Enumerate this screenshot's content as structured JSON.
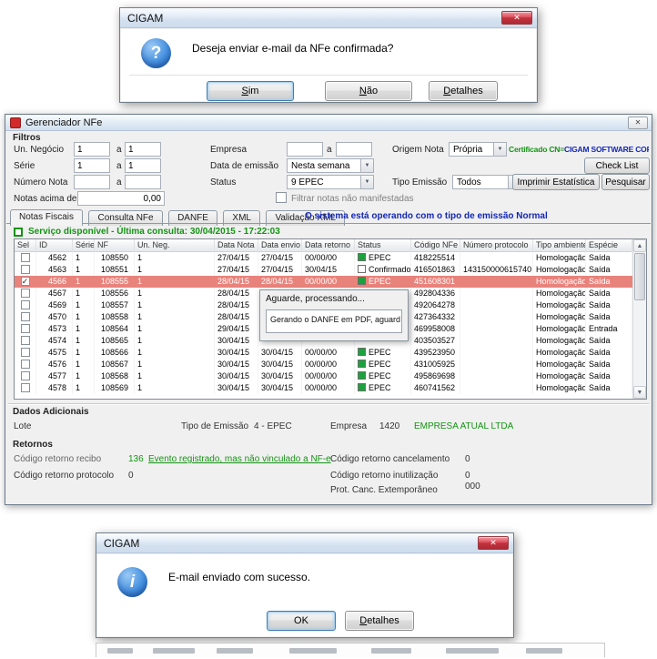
{
  "colors": {
    "epec_green": "#1aa23c",
    "confirmado_fill": "#ffffff",
    "selected_row": "#e8837c",
    "green_text": "#149414",
    "blue_text": "#1226b5"
  },
  "dialog_email_question": {
    "title": "CIGAM",
    "message": "Deseja enviar e-mail da NFe confirmada?",
    "buttons": {
      "yes": "Sim",
      "no": "Não",
      "details": "Detalhes"
    }
  },
  "dialog_email_success": {
    "title": "CIGAM",
    "message": "E-mail enviado com sucesso.",
    "buttons": {
      "ok": "OK",
      "details": "Detalhes"
    }
  },
  "progress_popup": {
    "title": "Aguarde, processando...",
    "message": "Gerando o DANFE em PDF, aguard"
  },
  "main": {
    "title": "Gerenciador NFe",
    "filters": {
      "legend": "Filtros",
      "a_label": "a",
      "un_negocio_label": "Un. Negócio",
      "un_negocio_from": "1",
      "un_negocio_to": "1",
      "serie_label": "Série",
      "serie_from": "1",
      "serie_to": "1",
      "numero_nota_label": "Número Nota",
      "numero_nota_from": "",
      "numero_nota_to": "",
      "notas_acima_label": "Notas acima de",
      "notas_acima_value": "0,00",
      "empresa_label": "Empresa",
      "empresa_from": "",
      "empresa_to": "",
      "data_emissao_label": "Data de emissão",
      "data_emissao_value": "Nesta semana",
      "status_label": "Status",
      "status_value": "9 EPEC",
      "origem_label": "Origem Nota",
      "origem_value": "Própria",
      "tipo_emissao_label": "Tipo Emissão",
      "tipo_emissao_value": "Todos",
      "certificado_prefix": "Certificado CN=",
      "certificado_value": "CIGAM SOFTWARE CORPORATIV",
      "check_list_button": "Check List",
      "imprimir_button": "Imprimir Estatística",
      "pesquisar_button": "Pesquisar",
      "filtrar_label": "Filtrar notas não manifestadas"
    },
    "tabs": [
      "Notas Fiscais",
      "Consulta NFe",
      "DANFE",
      "XML",
      "Validação XML"
    ],
    "emission_message": "O sistema está operando com o tipo de emissão Normal",
    "service_status": "Serviço disponível - Última consulta: 30/04/2015 - 17:22:03",
    "table": {
      "headers": [
        "Sel",
        "ID",
        "Série",
        "NF",
        "Un. Neg.",
        "Data Nota",
        "Data envio",
        "Data retorno",
        "Status",
        "Código NFe",
        "Número protocolo",
        "Tipo ambiente",
        "Espécie"
      ],
      "rows": [
        {
          "sel": false,
          "selected": false,
          "id": "4562",
          "serie": "1",
          "nf": "108550",
          "un": "1",
          "dn": "27/04/15",
          "de": "27/04/15",
          "dr": "00/00/00",
          "status": "EPEC",
          "st": "epec",
          "cod": "418225514",
          "prot": "",
          "amb": "Homologação",
          "esp": "Saída"
        },
        {
          "sel": false,
          "selected": false,
          "id": "4563",
          "serie": "1",
          "nf": "108551",
          "un": "1",
          "dn": "27/04/15",
          "de": "27/04/15",
          "dr": "30/04/15",
          "status": "Confirmado",
          "st": "confirmado",
          "cod": "416501863",
          "prot": "143150000615740",
          "amb": "Homologação",
          "esp": "Saída"
        },
        {
          "sel": true,
          "selected": true,
          "id": "4566",
          "serie": "1",
          "nf": "108555",
          "un": "1",
          "dn": "28/04/15",
          "de": "28/04/15",
          "dr": "00/00/00",
          "status": "EPEC",
          "st": "epec",
          "cod": "451608301",
          "prot": "",
          "amb": "Homologação",
          "esp": "Saída"
        },
        {
          "sel": false,
          "selected": false,
          "id": "4567",
          "serie": "1",
          "nf": "108556",
          "un": "1",
          "dn": "28/04/15",
          "de": "",
          "dr": "",
          "status": "",
          "st": "",
          "cod": "492804336",
          "prot": "",
          "amb": "Homologação",
          "esp": "Saída"
        },
        {
          "sel": false,
          "selected": false,
          "id": "4569",
          "serie": "1",
          "nf": "108557",
          "un": "1",
          "dn": "28/04/15",
          "de": "",
          "dr": "",
          "status": "",
          "st": "",
          "cod": "492064278",
          "prot": "",
          "amb": "Homologação",
          "esp": "Saída"
        },
        {
          "sel": false,
          "selected": false,
          "id": "4570",
          "serie": "1",
          "nf": "108558",
          "un": "1",
          "dn": "28/04/15",
          "de": "",
          "dr": "",
          "status": "",
          "st": "",
          "cod": "427364332",
          "prot": "",
          "amb": "Homologação",
          "esp": "Saída"
        },
        {
          "sel": false,
          "selected": false,
          "id": "4573",
          "serie": "1",
          "nf": "108564",
          "un": "1",
          "dn": "29/04/15",
          "de": "",
          "dr": "",
          "status": "",
          "st": "",
          "cod": "469958008",
          "prot": "",
          "amb": "Homologação",
          "esp": "Entrada"
        },
        {
          "sel": false,
          "selected": false,
          "id": "4574",
          "serie": "1",
          "nf": "108565",
          "un": "1",
          "dn": "30/04/15",
          "de": "",
          "dr": "",
          "status": "",
          "st": "",
          "cod": "403503527",
          "prot": "",
          "amb": "Homologação",
          "esp": "Saída"
        },
        {
          "sel": false,
          "selected": false,
          "id": "4575",
          "serie": "1",
          "nf": "108566",
          "un": "1",
          "dn": "30/04/15",
          "de": "30/04/15",
          "dr": "00/00/00",
          "status": "EPEC",
          "st": "epec",
          "cod": "439523950",
          "prot": "",
          "amb": "Homologação",
          "esp": "Saída"
        },
        {
          "sel": false,
          "selected": false,
          "id": "4576",
          "serie": "1",
          "nf": "108567",
          "un": "1",
          "dn": "30/04/15",
          "de": "30/04/15",
          "dr": "00/00/00",
          "status": "EPEC",
          "st": "epec",
          "cod": "431005925",
          "prot": "",
          "amb": "Homologação",
          "esp": "Saída"
        },
        {
          "sel": false,
          "selected": false,
          "id": "4577",
          "serie": "1",
          "nf": "108568",
          "un": "1",
          "dn": "30/04/15",
          "de": "30/04/15",
          "dr": "00/00/00",
          "status": "EPEC",
          "st": "epec",
          "cod": "495869698",
          "prot": "",
          "amb": "Homologação",
          "esp": "Saída"
        },
        {
          "sel": false,
          "selected": false,
          "id": "4578",
          "serie": "1",
          "nf": "108569",
          "un": "1",
          "dn": "30/04/15",
          "de": "30/04/15",
          "dr": "00/00/00",
          "status": "EPEC",
          "st": "epec",
          "cod": "460741562",
          "prot": "",
          "amb": "Homologação",
          "esp": "Saída"
        }
      ]
    },
    "dados_adicionais": {
      "title": "Dados Adicionais",
      "lote_label": "Lote",
      "tipo_emissao_label": "Tipo de Emissão",
      "tipo_emissao_value": "4 - EPEC",
      "empresa_label": "Empresa",
      "empresa_code": "1420",
      "empresa_name": "EMPRESA ATUAL LTDA"
    },
    "retornos": {
      "title": "Retornos",
      "recibo_label": "Código retorno recibo",
      "recibo_code": "136",
      "recibo_text": "Evento registrado, mas não vinculado a NF-e",
      "protocolo_label": "Código retorno protocolo",
      "protocolo_value": "0",
      "cancelamento_label": "Código retorno cancelamento",
      "cancelamento_value": "0",
      "inutilizacao_label": "Código retorno inutilização",
      "inutilizacao_value": "0",
      "prot_canc_label": "Prot. Canc. Extemporâneo",
      "prot_canc_value": "000"
    }
  }
}
